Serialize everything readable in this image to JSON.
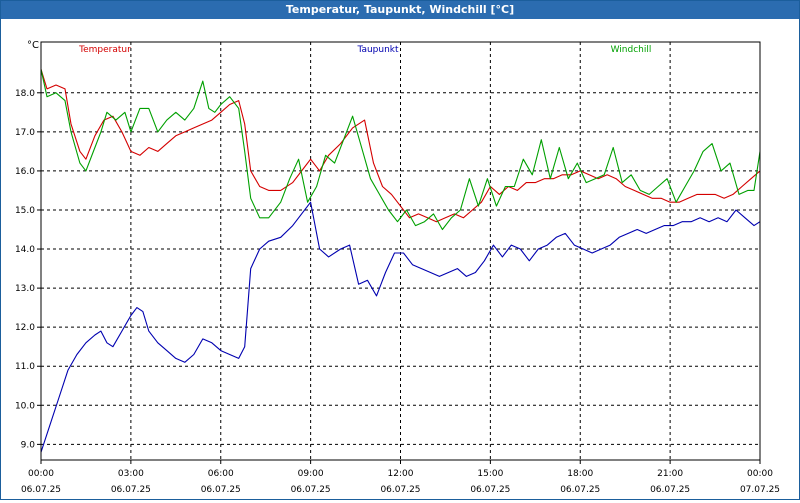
{
  "window": {
    "title": "Temperatur, Taupunkt, Windchill [°C]"
  },
  "chart_data": {
    "type": "line",
    "title": "Temperatur, Taupunkt, Windchill [°C]",
    "ylabel": "°C",
    "ylim": [
      8.6,
      19.3
    ],
    "xlim": [
      0,
      24
    ],
    "grid": true,
    "legend_placement": "top",
    "y_ticks": [
      "9.0",
      "10.0",
      "11.0",
      "12.0",
      "13.0",
      "14.0",
      "15.0",
      "16.0",
      "17.0",
      "18.0"
    ],
    "x_ticks": [
      {
        "time": "00:00",
        "date": "06.07.25"
      },
      {
        "time": "03:00",
        "date": "06.07.25"
      },
      {
        "time": "06:00",
        "date": "06.07.25"
      },
      {
        "time": "09:00",
        "date": "06.07.25"
      },
      {
        "time": "12:00",
        "date": "06.07.25"
      },
      {
        "time": "15:00",
        "date": "06.07.25"
      },
      {
        "time": "18:00",
        "date": "06.07.25"
      },
      {
        "time": "21:00",
        "date": "06.07.25"
      },
      {
        "time": "00:00",
        "date": "07.07.25"
      }
    ],
    "series": [
      {
        "name": "Temperatur",
        "color": "#d40000",
        "x": [
          0,
          0.2,
          0.5,
          0.8,
          1.0,
          1.3,
          1.5,
          1.8,
          2.1,
          2.4,
          2.7,
          3.0,
          3.3,
          3.6,
          3.9,
          4.2,
          4.5,
          4.8,
          5.1,
          5.4,
          5.7,
          6.0,
          6.3,
          6.6,
          6.8,
          7.0,
          7.3,
          7.6,
          8.0,
          8.4,
          8.8,
          9.0,
          9.3,
          9.6,
          10.0,
          10.4,
          10.8,
          11.1,
          11.4,
          11.7,
          12.0,
          12.3,
          12.6,
          12.9,
          13.2,
          13.5,
          13.8,
          14.1,
          14.4,
          14.7,
          15.0,
          15.3,
          15.6,
          15.9,
          16.2,
          16.5,
          16.8,
          17.1,
          17.4,
          17.7,
          18.0,
          18.3,
          18.6,
          18.9,
          19.2,
          19.5,
          19.8,
          20.1,
          20.4,
          20.7,
          21.0,
          21.3,
          21.6,
          21.9,
          22.2,
          22.5,
          22.8,
          23.1,
          23.4,
          23.7,
          24.0
        ],
        "values": [
          18.6,
          18.1,
          18.2,
          18.1,
          17.2,
          16.5,
          16.3,
          16.9,
          17.3,
          17.4,
          17.0,
          16.5,
          16.4,
          16.6,
          16.5,
          16.7,
          16.9,
          17.0,
          17.1,
          17.2,
          17.3,
          17.5,
          17.7,
          17.8,
          17.2,
          16.0,
          15.6,
          15.5,
          15.5,
          15.7,
          16.1,
          16.3,
          16.0,
          16.4,
          16.7,
          17.1,
          17.3,
          16.2,
          15.6,
          15.4,
          15.1,
          14.8,
          14.9,
          14.8,
          14.7,
          14.8,
          14.9,
          14.8,
          15.0,
          15.2,
          15.6,
          15.4,
          15.6,
          15.5,
          15.7,
          15.7,
          15.8,
          15.8,
          15.9,
          15.9,
          16.0,
          15.9,
          15.8,
          15.9,
          15.8,
          15.6,
          15.5,
          15.4,
          15.3,
          15.3,
          15.2,
          15.2,
          15.3,
          15.4,
          15.4,
          15.4,
          15.3,
          15.4,
          15.6,
          15.8,
          16.0
        ]
      },
      {
        "name": "Taupunkt",
        "color": "#0000b0",
        "x": [
          0,
          0.3,
          0.6,
          0.9,
          1.2,
          1.5,
          1.8,
          2.0,
          2.2,
          2.4,
          2.7,
          3.0,
          3.2,
          3.4,
          3.6,
          3.9,
          4.2,
          4.5,
          4.8,
          5.1,
          5.4,
          5.7,
          6.0,
          6.3,
          6.6,
          6.8,
          7.0,
          7.3,
          7.6,
          8.0,
          8.4,
          8.7,
          9.0,
          9.3,
          9.6,
          10.0,
          10.3,
          10.6,
          10.9,
          11.2,
          11.5,
          11.8,
          12.1,
          12.4,
          12.7,
          13.0,
          13.3,
          13.6,
          13.9,
          14.2,
          14.5,
          14.8,
          15.1,
          15.4,
          15.7,
          16.0,
          16.3,
          16.6,
          16.9,
          17.2,
          17.5,
          17.8,
          18.1,
          18.4,
          18.7,
          19.0,
          19.3,
          19.6,
          19.9,
          20.2,
          20.5,
          20.8,
          21.1,
          21.4,
          21.7,
          22.0,
          22.3,
          22.6,
          22.9,
          23.2,
          23.5,
          23.8,
          24.0
        ],
        "values": [
          8.8,
          9.5,
          10.2,
          10.9,
          11.3,
          11.6,
          11.8,
          11.9,
          11.6,
          11.5,
          11.9,
          12.3,
          12.5,
          12.4,
          11.9,
          11.6,
          11.4,
          11.2,
          11.1,
          11.3,
          11.7,
          11.6,
          11.4,
          11.3,
          11.2,
          11.5,
          13.5,
          14.0,
          14.2,
          14.3,
          14.6,
          14.9,
          15.2,
          14.0,
          13.8,
          14.0,
          14.1,
          13.1,
          13.2,
          12.8,
          13.4,
          13.9,
          13.9,
          13.6,
          13.5,
          13.4,
          13.3,
          13.4,
          13.5,
          13.3,
          13.4,
          13.7,
          14.1,
          13.8,
          14.1,
          14.0,
          13.7,
          14.0,
          14.1,
          14.3,
          14.4,
          14.1,
          14.0,
          13.9,
          14.0,
          14.1,
          14.3,
          14.4,
          14.5,
          14.4,
          14.5,
          14.6,
          14.6,
          14.7,
          14.7,
          14.8,
          14.7,
          14.8,
          14.7,
          15.0,
          14.8,
          14.6,
          14.7
        ]
      },
      {
        "name": "Windchill",
        "color": "#00a000",
        "x": [
          0,
          0.2,
          0.5,
          0.8,
          1.0,
          1.3,
          1.5,
          1.8,
          2.0,
          2.2,
          2.5,
          2.8,
          3.0,
          3.3,
          3.6,
          3.9,
          4.2,
          4.5,
          4.8,
          5.1,
          5.4,
          5.6,
          5.8,
          6.0,
          6.3,
          6.6,
          6.8,
          7.0,
          7.3,
          7.6,
          8.0,
          8.3,
          8.6,
          8.9,
          9.2,
          9.5,
          9.8,
          10.1,
          10.4,
          10.7,
          11.0,
          11.3,
          11.6,
          11.9,
          12.2,
          12.5,
          12.8,
          13.1,
          13.4,
          13.7,
          14.0,
          14.3,
          14.6,
          14.9,
          15.2,
          15.5,
          15.8,
          16.1,
          16.4,
          16.7,
          17.0,
          17.3,
          17.6,
          17.9,
          18.2,
          18.5,
          18.8,
          19.1,
          19.4,
          19.7,
          20.0,
          20.3,
          20.6,
          20.9,
          21.2,
          21.5,
          21.8,
          22.1,
          22.4,
          22.7,
          23.0,
          23.3,
          23.6,
          23.8,
          24.0
        ],
        "values": [
          18.6,
          17.9,
          18.0,
          17.8,
          17.0,
          16.2,
          16.0,
          16.6,
          17.0,
          17.5,
          17.3,
          17.5,
          17.0,
          17.6,
          17.6,
          17.0,
          17.3,
          17.5,
          17.3,
          17.6,
          18.3,
          17.6,
          17.5,
          17.7,
          17.9,
          17.6,
          16.5,
          15.3,
          14.8,
          14.8,
          15.2,
          15.8,
          16.3,
          15.2,
          15.6,
          16.4,
          16.2,
          16.8,
          17.4,
          16.6,
          15.8,
          15.4,
          15.0,
          14.7,
          15.0,
          14.6,
          14.7,
          14.9,
          14.5,
          14.8,
          15.0,
          15.8,
          15.1,
          15.8,
          15.1,
          15.6,
          15.6,
          16.3,
          15.9,
          16.8,
          15.8,
          16.6,
          15.8,
          16.2,
          15.7,
          15.8,
          15.9,
          16.6,
          15.7,
          15.9,
          15.5,
          15.4,
          15.6,
          15.8,
          15.2,
          15.6,
          16.0,
          16.5,
          16.7,
          16.0,
          16.2,
          15.4,
          15.5,
          15.5,
          16.5
        ]
      }
    ]
  }
}
